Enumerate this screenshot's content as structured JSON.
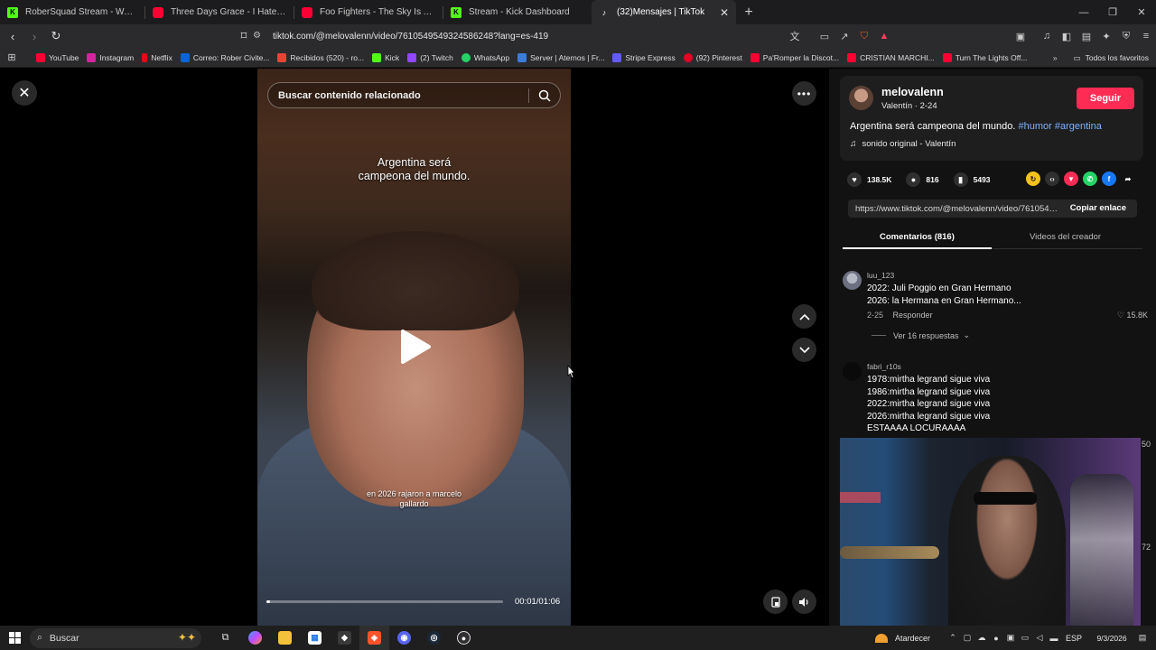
{
  "browser": {
    "tabs": [
      {
        "title": "RoberSquad Stream - Watch Live",
        "icon": "kick-icon",
        "color": "#53fc18"
      },
      {
        "title": "Three Days Grace - I Hate Everything",
        "icon": "youtube-icon",
        "color": "#ff0033"
      },
      {
        "title": "Foo Fighters - The Sky Is A Neighbor",
        "icon": "youtube-icon",
        "color": "#ff0033"
      },
      {
        "title": "Stream - Kick Dashboard",
        "icon": "kick-icon",
        "color": "#53fc18"
      },
      {
        "title": "(32)Mensajes | TikTok",
        "icon": "tiktok-icon",
        "color": "#ffffff",
        "active": true
      }
    ],
    "url": "tiktok.com/@melovalenn/video/7610549549324586248?lang=es-419",
    "bookmarks": [
      {
        "label": "YouTube",
        "color": "#ff0033"
      },
      {
        "label": "Instagram",
        "color": "#d6249f"
      },
      {
        "label": "Netflix",
        "color": "#e50914"
      },
      {
        "label": "Correo: Rober Civite...",
        "color": "#0a64d6"
      },
      {
        "label": "Recibidos (520) - ro...",
        "color": "#ea4335"
      },
      {
        "label": "Kick",
        "color": "#53fc18"
      },
      {
        "label": "(2) Twitch",
        "color": "#9146ff"
      },
      {
        "label": "WhatsApp",
        "color": "#25d366"
      },
      {
        "label": "Server | Aternos | Fr...",
        "color": "#3b7dd8"
      },
      {
        "label": "Stripe Express",
        "color": "#635bff"
      },
      {
        "label": "(92) Pinterest",
        "color": "#e60023"
      },
      {
        "label": "Pa'Romper la Discot...",
        "color": "#ff0033"
      },
      {
        "label": "CRISTIAN MARCHI...",
        "color": "#ff0033"
      },
      {
        "label": "Turn The Lights Off...",
        "color": "#ff0033"
      }
    ],
    "all_bookmarks": "Todos los favoritos"
  },
  "video": {
    "search_placeholder": "Buscar contenido relacionado",
    "caption_top_1": "Argentina será",
    "caption_top_2": "campeona del mundo.",
    "caption_bottom_1": "en 2026 rajaron a marcelo",
    "caption_bottom_2": "gallardo",
    "time": "00:01/01:06",
    "progress": 0.015
  },
  "post": {
    "username": "melovalenn",
    "subline": "Valentín · 2-24",
    "follow": "Seguir",
    "description": "Argentina será campeona del mundo.",
    "tag1": "#humor",
    "tag2": "#argentina",
    "music": "sonido original - Valentín",
    "likes": "138.5K",
    "comments": "816",
    "saves": "5493",
    "share_link": "https://www.tiktok.com/@melovalenn/video/7610549549324586248",
    "copy_link": "Copiar enlace",
    "tab_comments": "Comentarios (816)",
    "tab_videos": "Videos del creador"
  },
  "comments": [
    {
      "user": "luu_123",
      "line1": "2022: Juli Poggio en Gran Hermano",
      "line2": "2026: la Hermana en Gran Hermano...",
      "date": "2-25",
      "reply": "Responder",
      "likes": "15.8K",
      "replies": "Ver 16 respuestas"
    },
    {
      "user": "fabri_r10s",
      "lines": [
        "1978:mirtha legrand sigue viva",
        "1986:mirtha legrand sigue viva",
        "2022:mirtha legrand sigue viva",
        "2026:mirtha legrand sigue viva",
        "ESTAAAA LOCURAAAA"
      ]
    }
  ],
  "edge_numbers": {
    "a": "50",
    "b": "72"
  },
  "taskbar": {
    "search": "Buscar",
    "weather": "Atardecer",
    "lang": "ESP",
    "date": "9/3/2026"
  }
}
